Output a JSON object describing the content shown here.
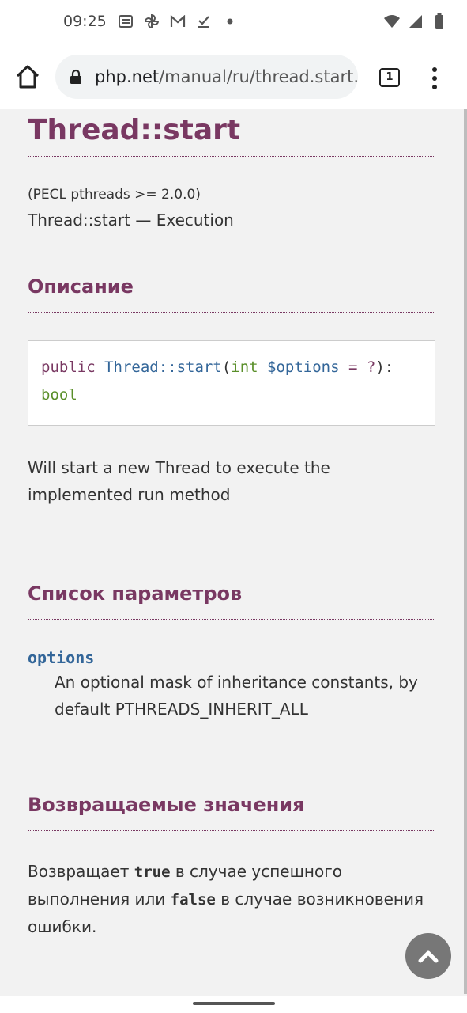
{
  "status_bar": {
    "time": "09:25",
    "left_icons": [
      "news-icon",
      "pinwheel-icon",
      "gmail-icon",
      "task-check-icon",
      "dot-icon"
    ],
    "right_icons": [
      "wifi-icon",
      "signal-icon",
      "battery-icon"
    ]
  },
  "browser": {
    "url_host": "php.net",
    "url_path": "/manual/ru/thread.start.",
    "tab_count": "1"
  },
  "page": {
    "title": "Thread::start",
    "version": "(PECL pthreads >= 2.0.0)",
    "refpurpose": "Thread::start — Execution",
    "description_heading": "Описание",
    "synopsis": {
      "modifier": "public",
      "method": "Thread::start",
      "open_paren": "(",
      "param_type": "int",
      "param_var": "$options",
      "default": " = ?",
      "close": "):",
      "return_type": "bool"
    },
    "description_text": "Will start a new Thread to execute the implemented run method",
    "params_heading": "Список параметров",
    "param_name": "options",
    "param_desc": "An optional mask of inheritance constants, by default PTHREADS_INHERIT_ALL",
    "return_heading": "Возвращаемые значения",
    "return_prefix": "Возвращает ",
    "return_true": "true",
    "return_mid": " в случае успешного выполнения или ",
    "return_false": "false",
    "return_suffix": " в случае возникновения ошибки."
  },
  "colors": {
    "heading": "#793862",
    "accent_blue": "#336699",
    "type_green": "#5a8f2a",
    "to_top_button": "#777777"
  }
}
